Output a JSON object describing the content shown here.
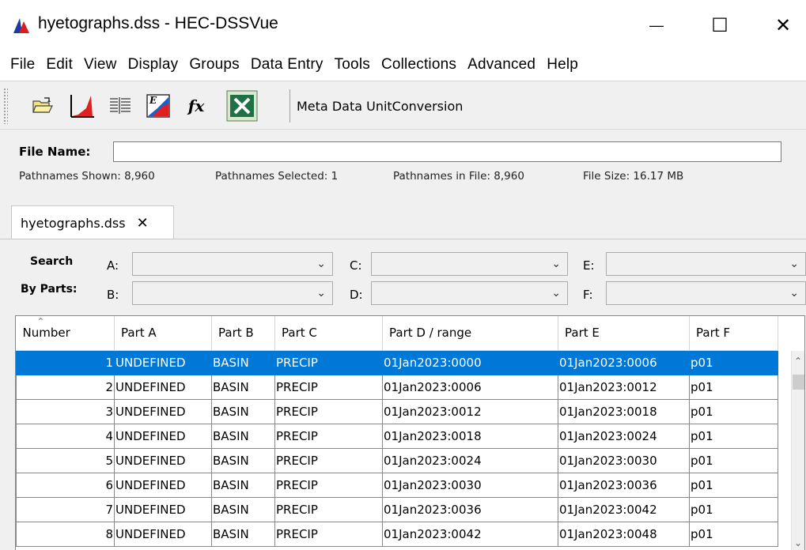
{
  "window": {
    "title": "hyetographs.dss - HEC-DSSVue",
    "minimize_glyph": "—",
    "maximize_glyph": "☐",
    "close_glyph": "✕"
  },
  "menu": [
    "File",
    "Edit",
    "View",
    "Display",
    "Groups",
    "Data Entry",
    "Tools",
    "Collections",
    "Advanced",
    "Help"
  ],
  "toolbar": {
    "icons": [
      "open-folder-icon",
      "plot-icon",
      "tabulate-icon",
      "math-functions-icon",
      "fx-icon",
      "excel-icon"
    ],
    "fx_text": "fx",
    "meta_text": "Meta Data  UnitConversion"
  },
  "file_info": {
    "file_name_label": "File Name:",
    "file_name_value": "",
    "pathnames_shown": "Pathnames Shown:  8,960",
    "pathnames_selected": "Pathnames Selected: 1",
    "pathnames_in_file": "Pathnames in File:  8,960",
    "file_size": "File Size:  16.17  MB"
  },
  "tab": {
    "label": "hyetographs.dss",
    "close_glyph": "✕"
  },
  "search": {
    "label_line1": "Search",
    "label_line2": "By Parts:",
    "parts": {
      "a": "A:",
      "b": "B:",
      "c": "C:",
      "d": "D:",
      "e": "E:",
      "f": "F:"
    }
  },
  "table": {
    "headers": [
      "Number",
      "Part A",
      "Part B",
      "Part C",
      "Part D / range",
      "Part E",
      "Part F"
    ],
    "selected_row": 0,
    "rows": [
      [
        "1",
        "UNDEFINED",
        "BASIN",
        "PRECIP",
        "01Jan2023:0000",
        "01Jan2023:0006",
        "p01"
      ],
      [
        "2",
        "UNDEFINED",
        "BASIN",
        "PRECIP",
        "01Jan2023:0006",
        "01Jan2023:0012",
        "p01"
      ],
      [
        "3",
        "UNDEFINED",
        "BASIN",
        "PRECIP",
        "01Jan2023:0012",
        "01Jan2023:0018",
        "p01"
      ],
      [
        "4",
        "UNDEFINED",
        "BASIN",
        "PRECIP",
        "01Jan2023:0018",
        "01Jan2023:0024",
        "p01"
      ],
      [
        "5",
        "UNDEFINED",
        "BASIN",
        "PRECIP",
        "01Jan2023:0024",
        "01Jan2023:0030",
        "p01"
      ],
      [
        "6",
        "UNDEFINED",
        "BASIN",
        "PRECIP",
        "01Jan2023:0030",
        "01Jan2023:0036",
        "p01"
      ],
      [
        "7",
        "UNDEFINED",
        "BASIN",
        "PRECIP",
        "01Jan2023:0036",
        "01Jan2023:0042",
        "p01"
      ],
      [
        "8",
        "UNDEFINED",
        "BASIN",
        "PRECIP",
        "01Jan2023:0042",
        "01Jan2023:0048",
        "p01"
      ]
    ]
  },
  "colors": {
    "selection": "#0078d7",
    "toolbar_bg": "#f0f0f0",
    "plot_red": "#e02020",
    "excel_green": "#1e7145"
  }
}
